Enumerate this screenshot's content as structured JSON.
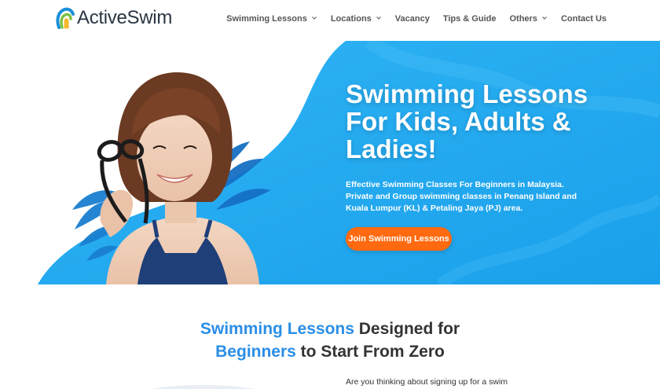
{
  "brand": {
    "name": "ActiveSwim",
    "colors": {
      "logo_blue": "#1a8fd8",
      "logo_green": "#7cc242",
      "logo_yellow": "#f5b82e",
      "text": "#2a3642"
    }
  },
  "nav": {
    "items": [
      {
        "label": "Swimming Lessons",
        "has_dropdown": true
      },
      {
        "label": "Locations",
        "has_dropdown": true
      },
      {
        "label": "Vacancy",
        "has_dropdown": false
      },
      {
        "label": "Tips & Guide",
        "has_dropdown": false
      },
      {
        "label": "Others",
        "has_dropdown": true
      },
      {
        "label": "Contact Us",
        "has_dropdown": false
      }
    ]
  },
  "hero": {
    "title": "Swimming Lessons For Kids, Adults & Ladies!",
    "description": "Effective Swimming Classes For Beginners in Malaysia. Private and Group swimming classes in Penang Island and Kuala Lumpur (KL) & Petaling Jaya (PJ) area.",
    "cta_label": "Join Swimming Lessons",
    "colors": {
      "background": "#25aaf0",
      "cta": "#ff6a10"
    }
  },
  "section": {
    "heading_line1_accent": "Swimming Lessons",
    "heading_line1_rest": " Designed for",
    "heading_line2_accent": "Beginners",
    "heading_line2_rest": " to Start From Zero",
    "body_start": "Are you thinking about signing up for a swim",
    "accent_color": "#2a8ee6"
  }
}
